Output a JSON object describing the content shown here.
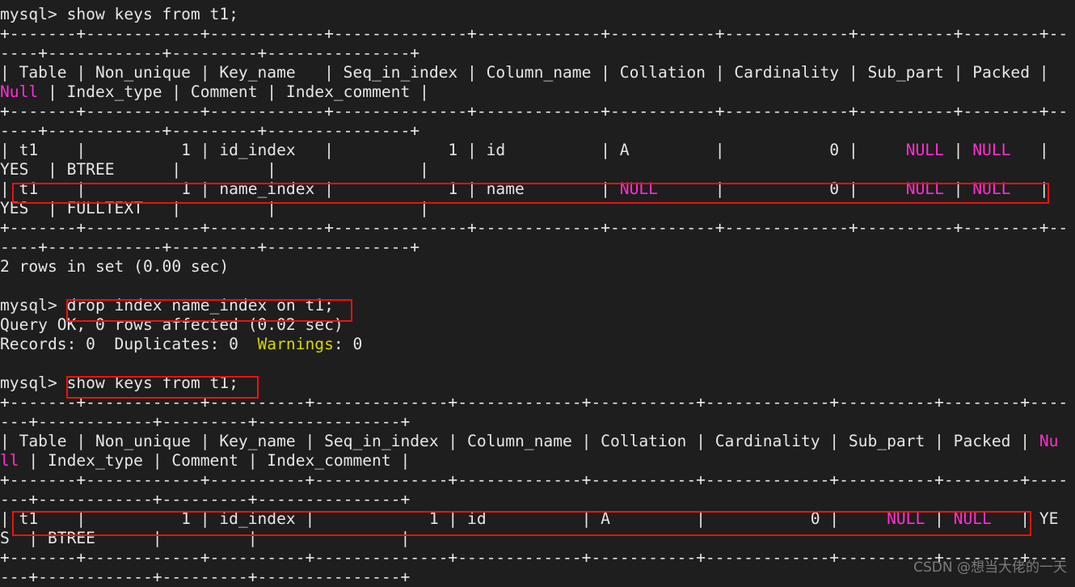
{
  "terminal": {
    "title": "mysql-terminal",
    "colors": {
      "background": "#1e1e1e",
      "foreground": "#e6e6e6",
      "null_magenta": "#ff2fd0",
      "warning_yellow": "#d7d700",
      "annotation_red": "#ee1111",
      "watermark_gray": "#9a9a9a"
    },
    "prompt": "mysql> ",
    "lines": [
      {
        "id": "l01",
        "text": "mysql> show keys from t1;"
      },
      {
        "id": "l02",
        "text": "+-------+------------+------------+--------------+-------------+-----------+-------------+----------+--------+--"
      },
      {
        "id": "l03",
        "text": "----+------------+---------+---------------+"
      },
      {
        "id": "l04",
        "text": "| Table | Non_unique | Key_name   | Seq_in_index | Column_name | Collation | Cardinality | Sub_part | Packed |"
      },
      {
        "id": "l05",
        "text": "Null | Index_type | Comment | Index_comment |",
        "null_prefix": "Null"
      },
      {
        "id": "l06",
        "text": "+-------+------------+------------+--------------+-------------+-----------+-------------+----------+--------+--"
      },
      {
        "id": "l07",
        "text": "----+------------+---------+---------------+"
      },
      {
        "id": "l08",
        "text": "| t1    |          1 | id_index   |            1 | id          | A         |           0 |     NULL | NULL   |"
      },
      {
        "id": "l09",
        "text": "YES  | BTREE      |         |               |"
      },
      {
        "id": "l10",
        "text": "| t1    |          1 | name_index |            1 | name        | NULL      |           0 |     NULL | NULL   |"
      },
      {
        "id": "l11",
        "text": "YES  | FULLTEXT   |         |               |"
      },
      {
        "id": "l12",
        "text": "+-------+------------+------------+--------------+-------------+-----------+-------------+----------+--------+--"
      },
      {
        "id": "l13",
        "text": "----+------------+---------+---------------+"
      },
      {
        "id": "l14",
        "text": "2 rows in set (0.00 sec)"
      },
      {
        "id": "l15",
        "text": ""
      },
      {
        "id": "l16",
        "text": "mysql> drop index name_index on t1;"
      },
      {
        "id": "l17",
        "text": "Query OK, 0 rows affected (0.02 sec)"
      },
      {
        "id": "l18",
        "text": "Records: 0  Duplicates: 0  Warnings: 0"
      },
      {
        "id": "l19",
        "text": ""
      },
      {
        "id": "l20",
        "text": "mysql> show keys from t1;"
      },
      {
        "id": "l21",
        "text": "+-------+------------+----------+--------------+-------------+-----------+-------------+----------+--------+----"
      },
      {
        "id": "l22",
        "text": "---+------------+---------+---------------+"
      },
      {
        "id": "l23",
        "text": "| Table | Non_unique | Key_name | Seq_in_index | Column_name | Collation | Cardinality | Sub_part | Packed | Nu"
      },
      {
        "id": "l24",
        "text": "ll | Index_type | Comment | Index_comment |",
        "null_prefix": "ll"
      },
      {
        "id": "l25",
        "text": "+-------+------------+----------+--------------+-------------+-----------+-------------+----------+--------+----"
      },
      {
        "id": "l26",
        "text": "---+------------+---------+---------------+"
      },
      {
        "id": "l27",
        "text": "| t1    |          1 | id_index |            1 | id          | A         |           0 |     NULL | NULL   | YE"
      },
      {
        "id": "l28",
        "text": "S  | BTREE      |         |               |"
      },
      {
        "id": "l29",
        "text": "+-------+------------+----------+--------------+-------------+-----------+-------------+----------+--------+----"
      },
      {
        "id": "l30",
        "text": "---+------------+---------+---------------+"
      }
    ],
    "commands": [
      {
        "name": "show-keys-1",
        "text": "show keys from t1;"
      },
      {
        "name": "drop-index",
        "text": "drop index name_index on t1;"
      },
      {
        "name": "show-keys-2",
        "text": "show keys from t1;"
      }
    ],
    "results": {
      "rows_in_set": "2 rows in set (0.00 sec)",
      "query_ok": "Query OK, 0 rows affected (0.02 sec)",
      "records_line_prefix": "Records: 0  Duplicates: 0  ",
      "warnings_label": "Warnings",
      "warnings_value": ": 0"
    },
    "tables": [
      {
        "name": "show-keys-before-drop",
        "columns": [
          "Table",
          "Non_unique",
          "Key_name",
          "Seq_in_index",
          "Column_name",
          "Collation",
          "Cardinality",
          "Sub_part",
          "Packed",
          "Null",
          "Index_type",
          "Comment",
          "Index_comment"
        ],
        "rows": [
          [
            "t1",
            "1",
            "id_index",
            "1",
            "id",
            "A",
            "0",
            "NULL",
            "NULL",
            "YES",
            "BTREE",
            "",
            ""
          ],
          [
            "t1",
            "1",
            "name_index",
            "1",
            "name",
            "NULL",
            "0",
            "NULL",
            "NULL",
            "YES",
            "FULLTEXT",
            "",
            ""
          ]
        ],
        "footer": "2 rows in set (0.00 sec)"
      },
      {
        "name": "show-keys-after-drop",
        "columns": [
          "Table",
          "Non_unique",
          "Key_name",
          "Seq_in_index",
          "Column_name",
          "Collation",
          "Cardinality",
          "Sub_part",
          "Packed",
          "Null",
          "Index_type",
          "Comment",
          "Index_comment"
        ],
        "rows": [
          [
            "t1",
            "1",
            "id_index",
            "1",
            "id",
            "A",
            "0",
            "NULL",
            "NULL",
            "YES",
            "BTREE",
            "",
            ""
          ]
        ],
        "footer": ""
      }
    ],
    "annotations": [
      {
        "name": "highlight-name-index-row",
        "target": "name_index row"
      },
      {
        "name": "highlight-drop-index-command",
        "target": "drop index name_index on t1;"
      },
      {
        "name": "highlight-show-keys-command",
        "target": "show keys from t1;"
      },
      {
        "name": "highlight-id-index-row",
        "target": "id_index row"
      }
    ],
    "watermark": "CSDN @想当大佬的一天"
  }
}
